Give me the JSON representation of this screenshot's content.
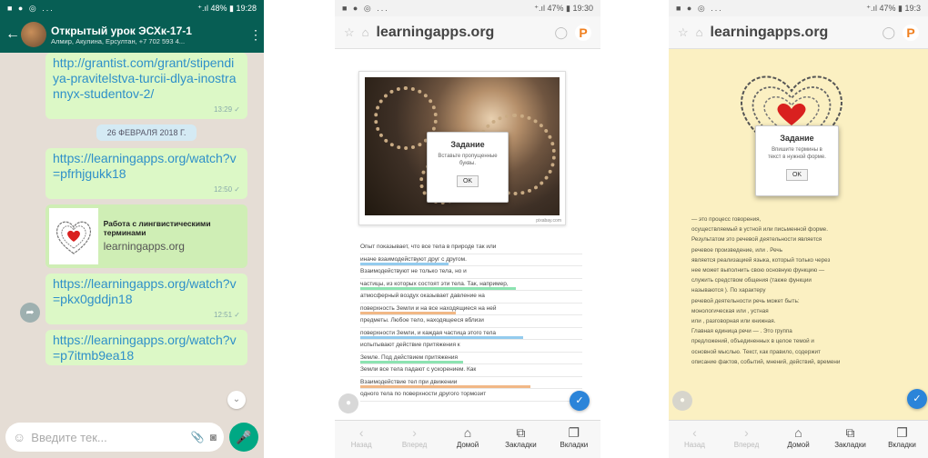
{
  "whatsapp": {
    "status_left": "■ ● ◎ ...",
    "status_right": "⁺.ıl 48% ▮ 19:28",
    "chat_title": "Открытый урок ЭСХк-17-1",
    "chat_subtitle": "Алмир, Акулина, Ерсултан, +7 702 593 4...",
    "messages": [
      {
        "type": "link",
        "text": "http://grantist.com/grant/stipendiya-pravitelstva-turcii-dlya-inostrannyx-studentov-2/",
        "time": "13:29 ✓"
      },
      {
        "type": "date",
        "text": "26 ФЕВРАЛЯ 2018 Г."
      },
      {
        "type": "link",
        "text": "https://learningapps.org/watch?v=pfrhjgukk18",
        "time": "12:50 ✓"
      },
      {
        "type": "preview",
        "title": "Работа с лингвистическими терминами",
        "domain": "learningapps.org"
      },
      {
        "type": "link",
        "text": "https://learningapps.org/watch?v=pkx0gddjn18",
        "time": "12:51 ✓"
      },
      {
        "type": "link",
        "text": "https://learningapps.org/watch?v=p7itmb9ea18",
        "time": ""
      }
    ],
    "input_placeholder": "Введите тек..."
  },
  "browser1": {
    "status_left": "■ ● ◎ ...",
    "status_right": "⁺.ıl 47% ▮ 19:30",
    "url": "learningapps.org",
    "dialog": {
      "title": "Задание",
      "body": "Вставьте пропущенные буквы.",
      "ok": "OK"
    },
    "credit": "pixabay.com",
    "text_rows": [
      "Опыт показывает, что все тела в природе так или",
      "иначе взаимодействуют друг с другом.",
      "Взаимодействуют не только тела, но и",
      "частицы, из которых состоят эти тела. Так, например,",
      "атмосферный воздух оказывает давление на",
      "поверхность Земли и на все находящиеся на ней",
      "предметы. Любое тело, находящееся вблизи",
      "поверхности Земли, и каждая частица этого тела",
      "испытывают действие притяжения к",
      "Земле. Под действием притяжения",
      "Земли все тела падают с ускорением. Как",
      "Взаимодействие тел при движении",
      "одного тела по поверхности другого тормозит"
    ],
    "nav": [
      {
        "label": "Назад",
        "glyph": "‹",
        "disabled": true
      },
      {
        "label": "Вперед",
        "glyph": "›",
        "disabled": true
      },
      {
        "label": "Домой",
        "glyph": "⌂",
        "disabled": false
      },
      {
        "label": "Закладки",
        "glyph": "⧉",
        "disabled": false
      },
      {
        "label": "Вкладки",
        "glyph": "❐",
        "disabled": false
      }
    ]
  },
  "browser2": {
    "status_left": "■ ● ◎ ...",
    "status_right": "⁺.ıl 47% ▮ 19:3",
    "url": "learningapps.org",
    "dialog": {
      "title": "Задание",
      "body": "Впишите термины в текст в нужной форме.",
      "ok": "OK"
    },
    "text_rows": [
      "— это процесс говорения,",
      "осуществляемый в устной или письменной форме.",
      "Результатом это речевой деятельности является",
      "речевое произведение, или . Речь",
      "является реализацией языка, который только через",
      "нее может выполнить свою основную функцию —",
      "служить средством общения (также функции",
      "называются ). По характеру",
      "речевой деятельности речь может быть:",
      "монологическая или , устная",
      "или , разговорная или книжная.",
      "Главная единица речи — . Это группа",
      "предложений, объединенных в целое темой и",
      "основной мыслью. Текст, как правило, содержит",
      "описание фактов, событий, мнений, действий, времени"
    ],
    "nav": [
      {
        "label": "Назад",
        "glyph": "‹",
        "disabled": true
      },
      {
        "label": "Вперед",
        "glyph": "›",
        "disabled": true
      },
      {
        "label": "Домой",
        "glyph": "⌂",
        "disabled": false
      },
      {
        "label": "Закладки",
        "glyph": "⧉",
        "disabled": false
      },
      {
        "label": "Вкладки",
        "glyph": "❐",
        "disabled": false
      }
    ]
  },
  "colors": {
    "wa_header": "#075e54",
    "wa_bubble": "#dcf8c6",
    "link": "#2f90c9",
    "fab": "#2b84d9",
    "page_yellow": "#fbf0c2"
  }
}
